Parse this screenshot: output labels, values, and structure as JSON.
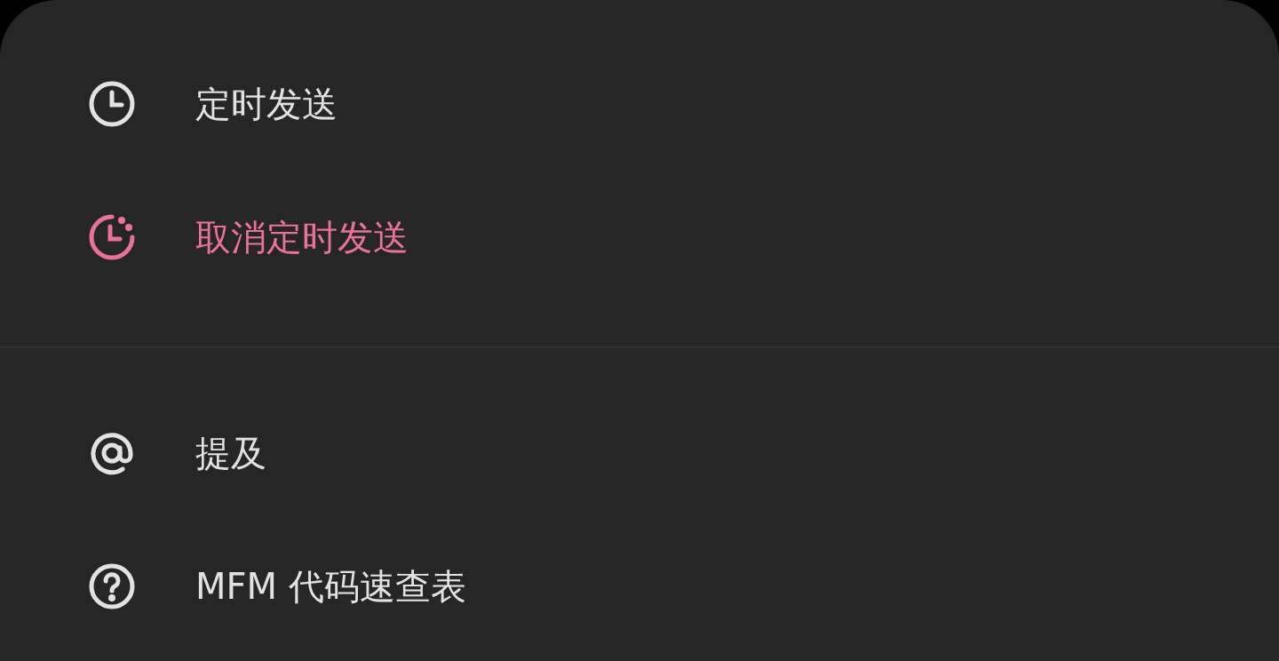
{
  "sections": [
    {
      "items": [
        {
          "kind": "clock",
          "label": "定时发送",
          "danger": false
        },
        {
          "kind": "cancel-clock",
          "label": "取消定时发送",
          "danger": true
        }
      ]
    },
    {
      "items": [
        {
          "kind": "mention",
          "label": "提及",
          "danger": false
        },
        {
          "kind": "help",
          "label": "MFM 代码速查表",
          "danger": false
        }
      ]
    }
  ]
}
